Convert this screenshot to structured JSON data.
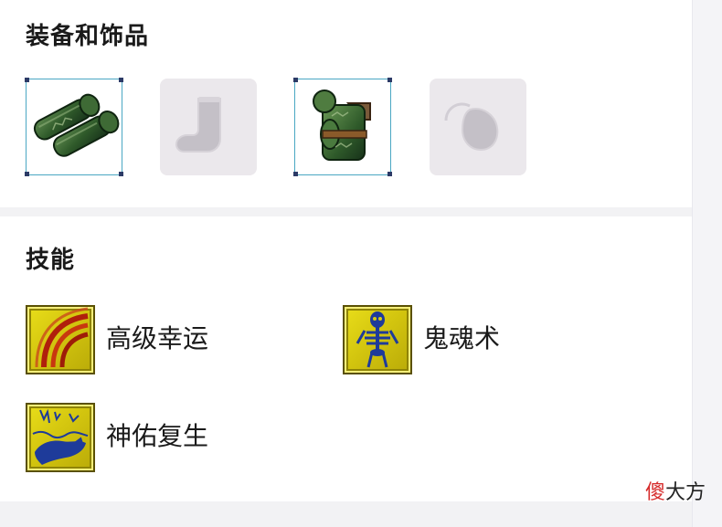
{
  "equipment": {
    "title": "装备和饰品",
    "slots": [
      {
        "state": "filled",
        "icon": "gloves-item-icon"
      },
      {
        "state": "empty",
        "icon": "boots-placeholder-icon"
      },
      {
        "state": "filled",
        "icon": "armor-item-icon"
      },
      {
        "state": "empty",
        "icon": "amulet-placeholder-icon"
      }
    ]
  },
  "skills": {
    "title": "技能",
    "items": [
      {
        "label": "高级幸运",
        "icon": "rainbow-skill-icon"
      },
      {
        "label": "鬼魂术",
        "icon": "skeleton-skill-icon"
      },
      {
        "label": "神佑复生",
        "icon": "resurrection-skill-icon"
      }
    ]
  },
  "watermark": {
    "char1": "傻",
    "char2": "大方"
  },
  "colors": {
    "slot_border": "#4aa7c3",
    "skill_icon_yellow": "#e0d414",
    "empty_slot_bg": "#ebe8ec"
  }
}
